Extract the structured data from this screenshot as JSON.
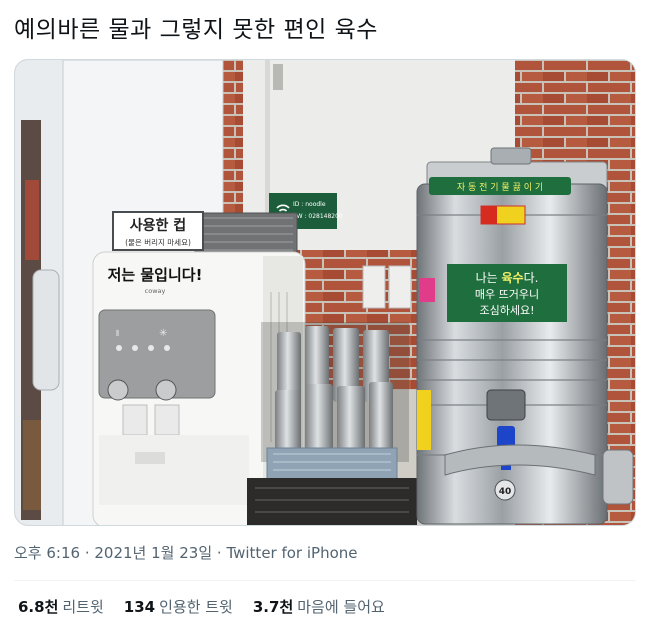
{
  "tweet": {
    "text": "예의바른 물과 그렇지 못한 편인 육수"
  },
  "photo": {
    "cup_sign_title": "사용한 컵",
    "cup_sign_sub": "(물은 버리지 마세요)",
    "purifier_label": "저는 물입니다!",
    "purifier_brand": "coway",
    "wifi_id": "ID : noodle",
    "wifi_pw": "PW : 028148200",
    "boiler_top_label": "자 동 전 기 물 끓 이 기",
    "boiler_sign_line1_a": "나는 ",
    "boiler_sign_line1_b": "육수",
    "boiler_sign_line1_c": "다.",
    "boiler_sign_line2": "매우 뜨거우니",
    "boiler_sign_line3": "조심하세요!",
    "boiler_number": "40"
  },
  "meta": {
    "time": "오후 6:16",
    "sep1": " · ",
    "date": "2021년 1월 23일",
    "sep2": " · ",
    "source": "Twitter for iPhone"
  },
  "stats": [
    {
      "count": "6.8천",
      "label": "리트윗"
    },
    {
      "count": "134",
      "label": "인용한 트윗"
    },
    {
      "count": "3.7천",
      "label": "마음에 들어요"
    }
  ]
}
